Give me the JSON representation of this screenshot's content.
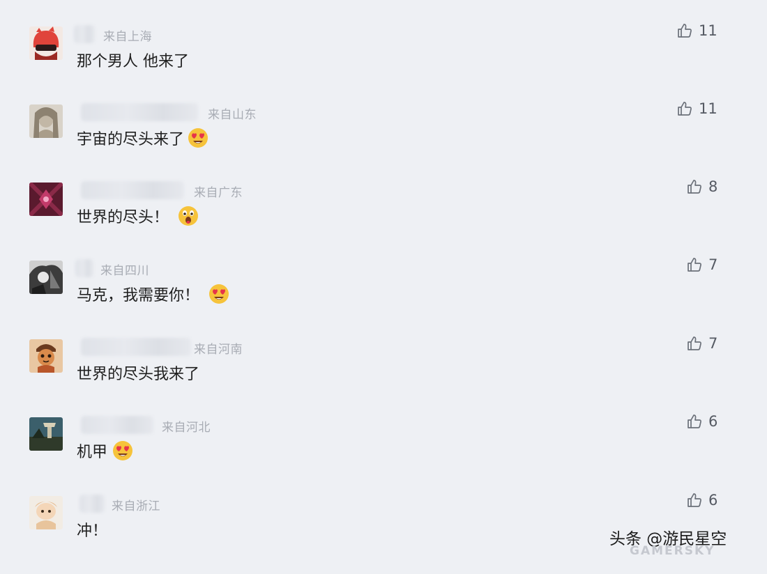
{
  "comments": [
    {
      "location": "来自上海",
      "text": "那个男人 他来了",
      "likes": "11",
      "emoji": ""
    },
    {
      "location": "来自山东",
      "text": "宇宙的尽头来了",
      "likes": "11",
      "emoji": "heart-eyes"
    },
    {
      "location": "来自广东",
      "text": "世界的尽头！",
      "likes": "8",
      "emoji": "surprised"
    },
    {
      "location": "来自四川",
      "text": "马克，我需要你！",
      "likes": "7",
      "emoji": "heart-eyes"
    },
    {
      "location": "来自河南",
      "text": "世界的尽头我来了",
      "likes": "7",
      "emoji": ""
    },
    {
      "location": "来自河北",
      "text": "机甲",
      "likes": "6",
      "emoji": "heart-eyes"
    },
    {
      "location": "来自浙江",
      "text": "冲！",
      "likes": "6",
      "emoji": ""
    }
  ],
  "watermark": {
    "text": "头条 @游民星空",
    "sub": "GAMERSKY"
  },
  "icons": {
    "like": "thumbs-up-icon"
  }
}
